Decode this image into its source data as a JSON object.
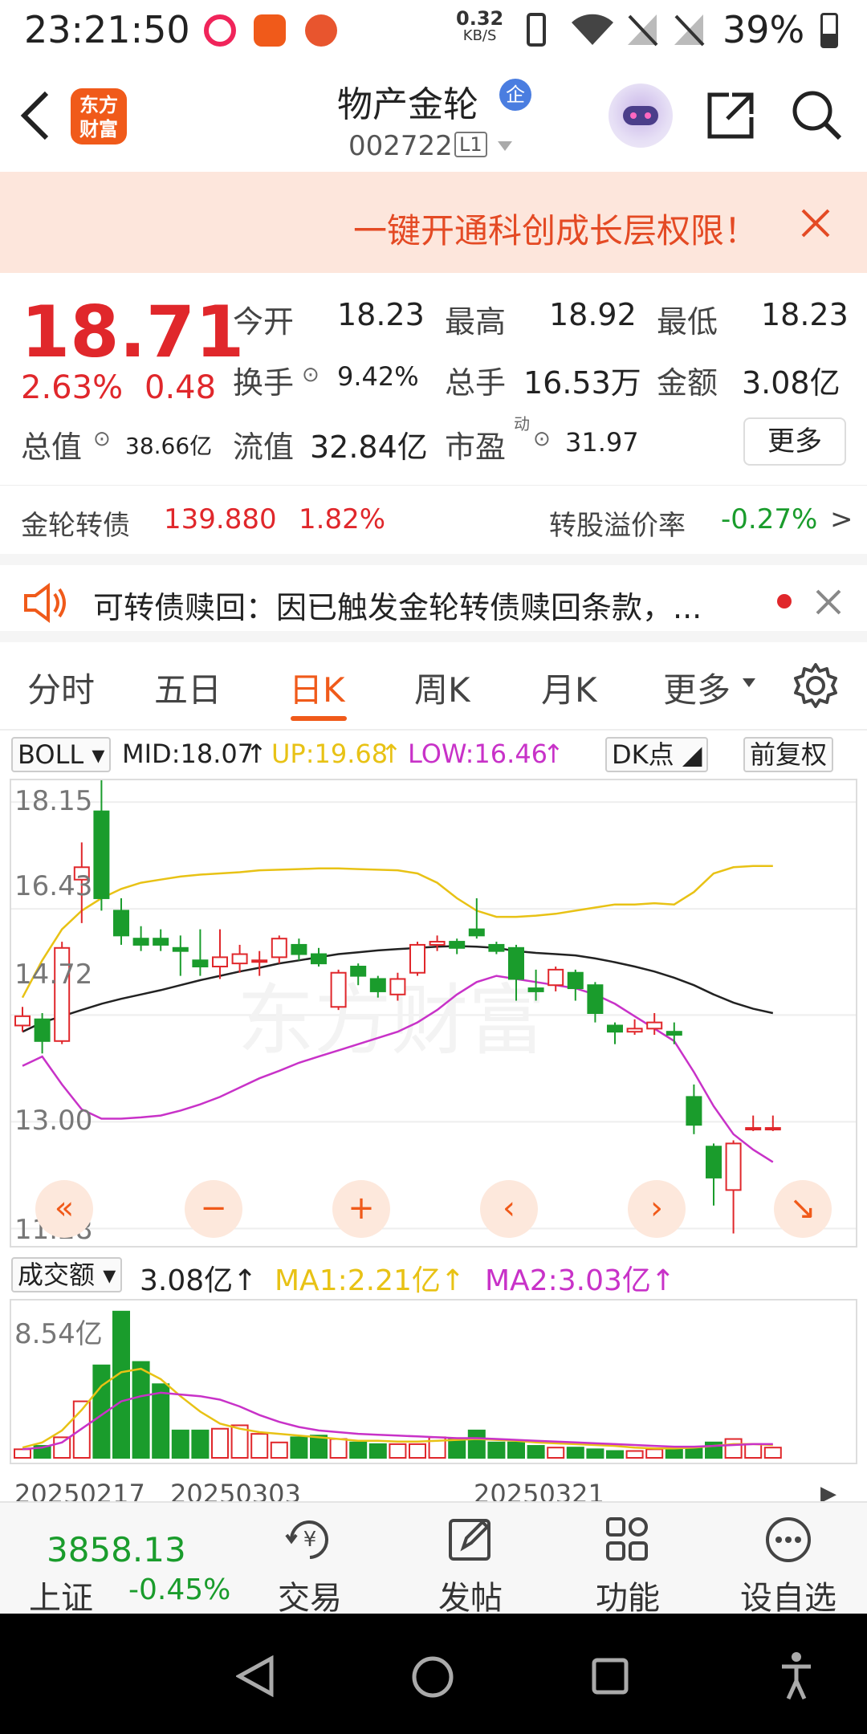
{
  "status_bar": {
    "time": "23:21:50",
    "net_speed": "0.32",
    "net_unit": "KB/S",
    "battery": "39%"
  },
  "header": {
    "title": "物产金轮",
    "title_badge": "企",
    "code": "002722",
    "level": "L1",
    "logo_line1": "东方",
    "logo_line2": "财富"
  },
  "banner": {
    "text": "一键开通科创成长层权限！"
  },
  "quote": {
    "price": "18.71",
    "change_pct": "2.63%",
    "change_amt": "0.48",
    "open_label": "今开",
    "open": "18.23",
    "high_label": "最高",
    "high": "18.92",
    "low_label": "最低",
    "low": "18.23",
    "turnover_label": "换手",
    "turnover": "9.42%",
    "volume_label": "总手",
    "volume": "16.53万",
    "amount_label": "金额",
    "amount": "3.08亿",
    "mktcap_label": "总值",
    "mktcap": "38.66亿",
    "float_label": "流值",
    "float": "32.84亿",
    "pe_label": "市盈",
    "pe_sup": "动",
    "pe": "31.97",
    "more": "更多"
  },
  "bond": {
    "name": "金轮转债",
    "price": "139.880",
    "pct": "1.82%",
    "premium_label": "转股溢价率",
    "premium": "-0.27%"
  },
  "notice": {
    "text": "可转债赎回：因已触发金轮转债赎回条款，..."
  },
  "tabs": [
    "分时",
    "五日",
    "日K",
    "周K",
    "月K",
    "更多"
  ],
  "indicator": {
    "name": "BOLL",
    "mid": "MID:18.07",
    "up": "UP:19.68",
    "low": "LOW:16.46",
    "dk": "DK点",
    "adjust": "前复权"
  },
  "chart_data": {
    "type": "candlestick",
    "y_tick_labels": [
      "18.15",
      "16.43",
      "14.72",
      "13.00",
      "11.28"
    ],
    "x_tick_labels": [
      "20250217",
      "20250303",
      "20250321"
    ],
    "candles": [
      {
        "o": 14.55,
        "h": 14.85,
        "l": 14.45,
        "c": 14.7
      },
      {
        "o": 14.65,
        "h": 14.75,
        "l": 14.1,
        "c": 14.3
      },
      {
        "o": 14.3,
        "h": 15.9,
        "l": 14.25,
        "c": 15.8
      },
      {
        "o": 16.9,
        "h": 17.5,
        "l": 16.2,
        "c": 17.1
      },
      {
        "o": 18.0,
        "h": 18.5,
        "l": 16.4,
        "c": 16.6
      },
      {
        "o": 16.4,
        "h": 16.6,
        "l": 15.85,
        "c": 16.0
      },
      {
        "o": 15.95,
        "h": 16.15,
        "l": 15.75,
        "c": 15.85
      },
      {
        "o": 15.95,
        "h": 16.1,
        "l": 15.75,
        "c": 15.85
      },
      {
        "o": 15.8,
        "h": 16.0,
        "l": 15.35,
        "c": 15.75
      },
      {
        "o": 15.6,
        "h": 16.1,
        "l": 15.35,
        "c": 15.5
      },
      {
        "o": 15.5,
        "h": 16.1,
        "l": 15.3,
        "c": 15.65
      },
      {
        "o": 15.55,
        "h": 15.85,
        "l": 15.4,
        "c": 15.7
      },
      {
        "o": 15.6,
        "h": 15.75,
        "l": 15.35,
        "c": 15.6
      },
      {
        "o": 15.65,
        "h": 16.0,
        "l": 15.55,
        "c": 15.95
      },
      {
        "o": 15.85,
        "h": 15.95,
        "l": 15.6,
        "c": 15.7
      },
      {
        "o": 15.7,
        "h": 15.8,
        "l": 15.5,
        "c": 15.55
      },
      {
        "o": 14.85,
        "h": 15.45,
        "l": 14.8,
        "c": 15.4
      },
      {
        "o": 15.5,
        "h": 15.55,
        "l": 15.2,
        "c": 15.35
      },
      {
        "o": 15.3,
        "h": 15.35,
        "l": 15.0,
        "c": 15.1
      },
      {
        "o": 15.05,
        "h": 15.4,
        "l": 14.95,
        "c": 15.3
      },
      {
        "o": 15.4,
        "h": 15.9,
        "l": 15.35,
        "c": 15.85
      },
      {
        "o": 15.85,
        "h": 16.0,
        "l": 15.75,
        "c": 15.9
      },
      {
        "o": 15.9,
        "h": 15.95,
        "l": 15.7,
        "c": 15.8
      },
      {
        "o": 16.1,
        "h": 16.6,
        "l": 15.95,
        "c": 16.0
      },
      {
        "o": 15.85,
        "h": 15.9,
        "l": 15.7,
        "c": 15.75
      },
      {
        "o": 15.8,
        "h": 15.85,
        "l": 14.95,
        "c": 15.3
      },
      {
        "o": 15.15,
        "h": 15.45,
        "l": 14.95,
        "c": 15.1
      },
      {
        "o": 15.2,
        "h": 15.5,
        "l": 15.1,
        "c": 15.45
      },
      {
        "o": 15.4,
        "h": 15.45,
        "l": 14.95,
        "c": 15.15
      },
      {
        "o": 15.2,
        "h": 15.25,
        "l": 14.6,
        "c": 14.75
      },
      {
        "o": 14.55,
        "h": 14.6,
        "l": 14.25,
        "c": 14.45
      },
      {
        "o": 14.45,
        "h": 14.65,
        "l": 14.4,
        "c": 14.5
      },
      {
        "o": 14.5,
        "h": 14.75,
        "l": 14.4,
        "c": 14.6
      },
      {
        "o": 14.45,
        "h": 14.6,
        "l": 14.25,
        "c": 14.4
      },
      {
        "o": 13.4,
        "h": 13.6,
        "l": 12.8,
        "c": 12.95
      },
      {
        "o": 12.6,
        "h": 12.65,
        "l": 11.65,
        "c": 12.1
      },
      {
        "o": 11.9,
        "h": 12.7,
        "l": 11.2,
        "c": 12.65
      },
      {
        "o": 12.9,
        "h": 13.1,
        "l": 12.85,
        "c": 12.9
      },
      {
        "o": 12.9,
        "h": 13.1,
        "l": 12.85,
        "c": 12.9
      }
    ],
    "boll_up": [
      15.0,
      15.6,
      16.1,
      16.4,
      16.6,
      16.75,
      16.85,
      16.9,
      16.95,
      16.98,
      17.0,
      17.02,
      17.05,
      17.06,
      17.07,
      17.08,
      17.08,
      17.07,
      17.06,
      17.05,
      17.0,
      16.85,
      16.6,
      16.4,
      16.3,
      16.3,
      16.32,
      16.35,
      16.4,
      16.45,
      16.5,
      16.5,
      16.52,
      16.5,
      16.7,
      17.0,
      17.1,
      17.12,
      17.12
    ],
    "boll_mid": [
      14.45,
      14.6,
      14.7,
      14.8,
      14.9,
      14.98,
      15.05,
      15.12,
      15.2,
      15.28,
      15.35,
      15.42,
      15.48,
      15.55,
      15.6,
      15.65,
      15.7,
      15.73,
      15.76,
      15.78,
      15.8,
      15.82,
      15.83,
      15.82,
      15.8,
      15.75,
      15.72,
      15.7,
      15.68,
      15.63,
      15.57,
      15.5,
      15.42,
      15.32,
      15.2,
      15.05,
      14.92,
      14.82,
      14.75
    ],
    "boll_low": [
      13.9,
      14.05,
      13.6,
      13.2,
      13.05,
      13.05,
      13.07,
      13.1,
      13.18,
      13.28,
      13.4,
      13.55,
      13.7,
      13.82,
      13.95,
      14.05,
      14.15,
      14.25,
      14.35,
      14.45,
      14.6,
      14.8,
      15.05,
      15.25,
      15.35,
      15.3,
      15.25,
      15.2,
      15.15,
      15.05,
      14.9,
      14.7,
      14.5,
      14.3,
      13.8,
      13.25,
      12.8,
      12.55,
      12.35
    ],
    "volume_label": "成交额",
    "volume_current": "3.08亿",
    "volume_ma1": "MA1:2.21亿",
    "volume_ma2": "MA2:3.03亿",
    "volume_max_label": "8.54亿",
    "volumes": [
      0.5,
      0.7,
      1.2,
      3.3,
      5.4,
      8.54,
      5.6,
      4.3,
      1.6,
      1.6,
      1.7,
      1.9,
      1.4,
      0.9,
      1.2,
      1.3,
      1.1,
      0.9,
      0.8,
      0.8,
      0.8,
      1.2,
      1.1,
      1.6,
      0.9,
      0.9,
      0.7,
      0.6,
      0.6,
      0.5,
      0.4,
      0.4,
      0.5,
      0.5,
      0.6,
      0.9,
      1.1,
      0.8,
      0.6
    ],
    "vol_ma1": [
      0.6,
      0.9,
      1.6,
      2.8,
      4.2,
      5.0,
      5.2,
      4.6,
      3.6,
      2.7,
      2.0,
      1.7,
      1.5,
      1.4,
      1.3,
      1.2,
      1.1,
      1.0,
      1.0,
      0.95,
      0.95,
      1.0,
      1.05,
      1.1,
      1.05,
      1.0,
      0.9,
      0.85,
      0.8,
      0.75,
      0.7,
      0.6,
      0.55,
      0.55,
      0.6,
      0.7,
      0.8,
      0.8,
      0.75
    ],
    "vol_ma2": [
      0.5,
      0.6,
      0.9,
      1.7,
      2.5,
      3.3,
      3.6,
      3.8,
      3.7,
      3.6,
      3.4,
      3.0,
      2.5,
      2.1,
      1.8,
      1.6,
      1.5,
      1.4,
      1.35,
      1.3,
      1.25,
      1.2,
      1.15,
      1.15,
      1.1,
      1.05,
      1.0,
      0.95,
      0.9,
      0.85,
      0.8,
      0.75,
      0.7,
      0.65,
      0.65,
      0.7,
      0.75,
      0.8,
      0.8
    ]
  },
  "colors": {
    "up": "#e0272b",
    "down": "#1a9c2c",
    "boll_up": "#e8c215",
    "boll_mid": "#222222",
    "boll_low": "#c832c8",
    "accent": "#f05a1a"
  },
  "bottom_bar": {
    "index_value": "3858.13",
    "index_name": "上证",
    "index_change": "-0.45%",
    "items": [
      "交易",
      "发帖",
      "功能",
      "设自选"
    ]
  },
  "watermark": "东方财富"
}
